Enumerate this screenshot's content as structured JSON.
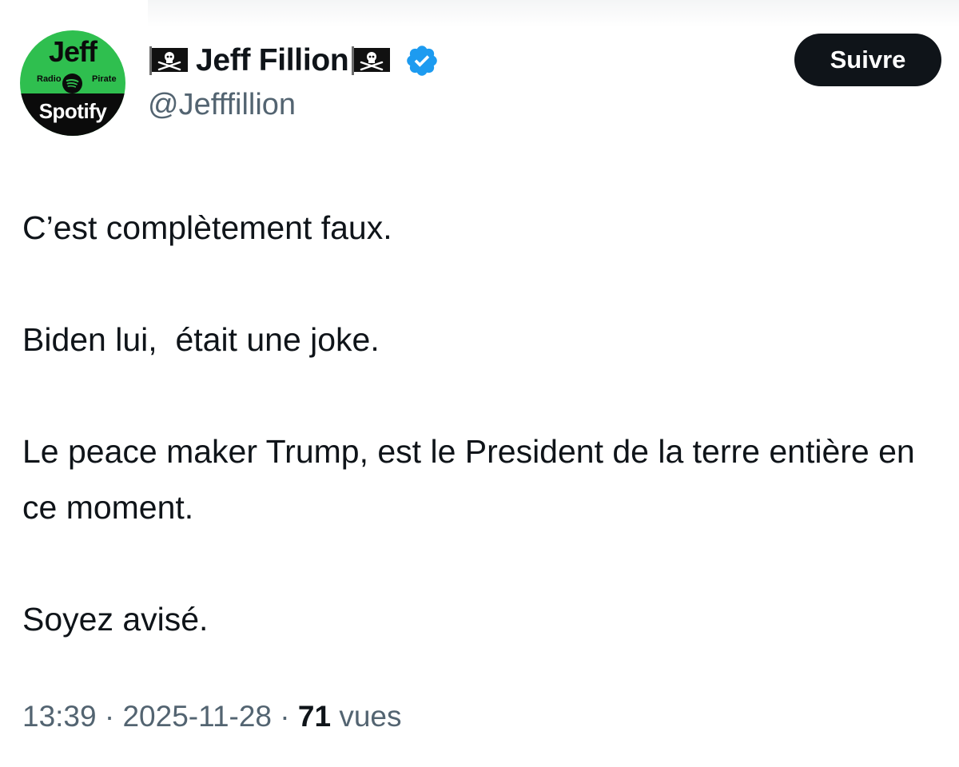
{
  "avatar": {
    "top_text": "Jeff",
    "left_small": "Radio",
    "right_small": "Pirate",
    "bottom_text": "Spotify",
    "bg_color": "#2fbf4f"
  },
  "author": {
    "display_name": "Jeff Fillion",
    "handle": "@Jefffillion",
    "verified": true,
    "name_emoji_icon": "pirate-flag-icon"
  },
  "follow_button": {
    "label": "Suivre"
  },
  "tweet": {
    "paragraphs": [
      "C’est complètement faux.",
      "Biden lui,  était une joke.",
      "Le peace maker Trump, est le President de la terre entière en ce moment.",
      "Soyez avisé."
    ]
  },
  "meta": {
    "time": "13:39",
    "separator": "·",
    "date": "2025-11-28",
    "views_count": "71",
    "views_label": "vues"
  },
  "colors": {
    "text": "#0f1419",
    "secondary_text": "#536471",
    "verified_blue": "#1d9bf0",
    "button_bg": "#0f1419"
  }
}
